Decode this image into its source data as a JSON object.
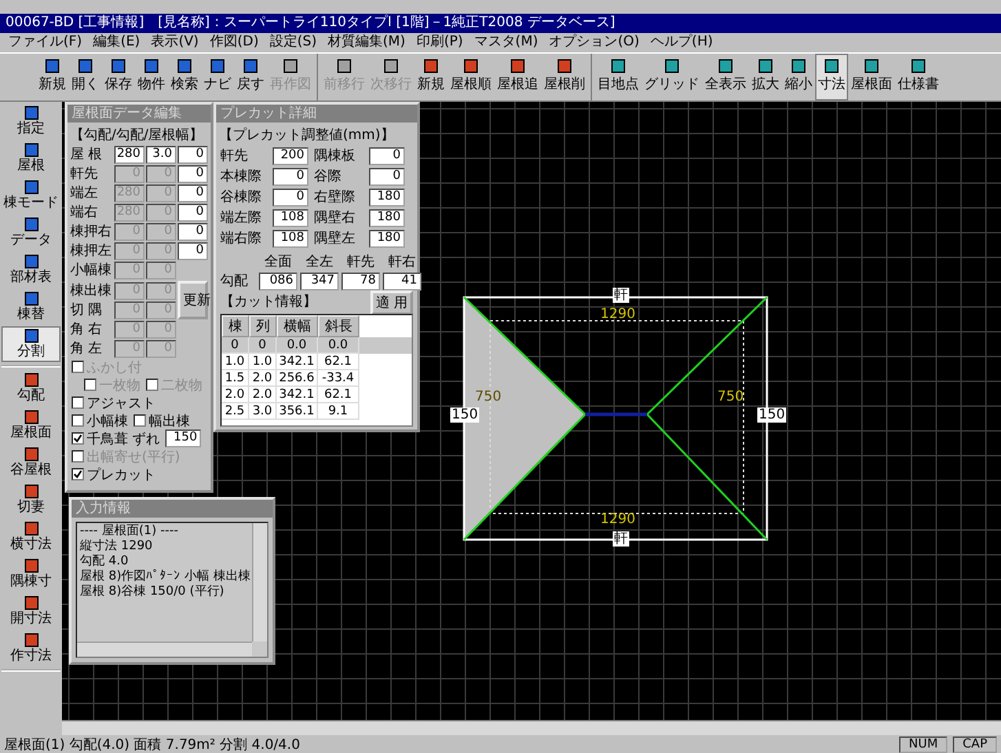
{
  "window": {
    "title": "00067-BD [工事情報]　[見名称]：スーパートライ110タイプⅠ [1階]－1純正T2008 データベース]"
  },
  "menu": [
    "ファイル(F)",
    "編集(E)",
    "表示(V)",
    "作図(D)",
    "設定(S)",
    "材質編集(M)",
    "印刷(P)",
    "マスタ(M)",
    "オプション(O)",
    "ヘルプ(H)"
  ],
  "toolbar": [
    [
      {
        "label": "新規",
        "disabled": false,
        "selected": false
      },
      {
        "label": "開く",
        "disabled": false,
        "selected": false
      },
      {
        "label": "保存",
        "disabled": false,
        "selected": false
      },
      {
        "label": "物件",
        "disabled": false,
        "selected": false
      },
      {
        "label": "検索",
        "disabled": false,
        "selected": false
      },
      {
        "label": "ナビ",
        "disabled": false,
        "selected": false
      },
      {
        "label": "戻す",
        "disabled": false,
        "selected": false
      },
      {
        "label": "再作図",
        "disabled": true,
        "selected": false
      }
    ],
    [
      {
        "label": "前移行",
        "disabled": true,
        "selected": false
      },
      {
        "label": "次移行",
        "disabled": true,
        "selected": false
      },
      {
        "label": "新規",
        "disabled": false,
        "selected": false
      },
      {
        "label": "屋根順",
        "disabled": false,
        "selected": false
      },
      {
        "label": "屋根追",
        "disabled": false,
        "selected": false
      },
      {
        "label": "屋根削",
        "disabled": false,
        "selected": false
      }
    ],
    [
      {
        "label": "目地点",
        "disabled": false,
        "selected": false
      },
      {
        "label": "グリッド",
        "disabled": false,
        "selected": false
      },
      {
        "label": "全表示",
        "disabled": false,
        "selected": false
      },
      {
        "label": "拡大",
        "disabled": false,
        "selected": false
      },
      {
        "label": "縮小",
        "disabled": false,
        "selected": false
      },
      {
        "label": "寸法",
        "disabled": false,
        "selected": true
      },
      {
        "label": "屋根面",
        "disabled": false,
        "selected": false
      },
      {
        "label": "仕様書",
        "disabled": false,
        "selected": false
      }
    ]
  ],
  "side_tools": [
    [
      {
        "label": "指定",
        "selected": false
      },
      {
        "label": "屋根",
        "selected": false
      },
      {
        "label": "棟モード",
        "selected": false
      },
      {
        "label": "データ",
        "selected": false
      },
      {
        "label": "部材表",
        "selected": false
      },
      {
        "label": "棟替",
        "selected": false
      },
      {
        "label": "分割",
        "selected": true
      }
    ],
    [
      {
        "label": "勾配",
        "selected": false
      },
      {
        "label": "屋根面",
        "selected": false
      },
      {
        "label": "谷屋根",
        "selected": false
      },
      {
        "label": "切妻",
        "selected": false
      },
      {
        "label": "横寸法",
        "selected": false
      },
      {
        "label": "隅棟寸",
        "selected": false
      },
      {
        "label": "開寸法",
        "selected": false
      },
      {
        "label": "作寸法",
        "selected": false
      }
    ]
  ],
  "roof_panel": {
    "title": "屋根面データ編集",
    "heading": "【勾配/勾配/屋根幅】",
    "rows": [
      {
        "label": "屋 根",
        "values": [
          {
            "text": "280",
            "disabled": false
          },
          {
            "text": "3.0",
            "disabled": false
          },
          {
            "text": "0",
            "disabled": false
          }
        ]
      },
      {
        "label": "軒先",
        "values": [
          {
            "text": "0",
            "disabled": true
          },
          {
            "text": "0",
            "disabled": true
          },
          {
            "text": "0",
            "disabled": false
          }
        ]
      },
      {
        "label": "端左",
        "values": [
          {
            "text": "280",
            "disabled": true
          },
          {
            "text": "0",
            "disabled": true
          },
          {
            "text": "0",
            "disabled": false
          }
        ]
      },
      {
        "label": "端右",
        "values": [
          {
            "text": "280",
            "disabled": true
          },
          {
            "text": "0",
            "disabled": true
          },
          {
            "text": "0",
            "disabled": false
          }
        ]
      },
      {
        "label": "棟押右",
        "values": [
          {
            "text": "0",
            "disabled": true
          },
          {
            "text": "0",
            "disabled": true
          },
          {
            "text": "0",
            "disabled": false
          }
        ]
      },
      {
        "label": "棟押左",
        "values": [
          {
            "text": "0",
            "disabled": true
          },
          {
            "text": "0",
            "disabled": true
          },
          {
            "text": "0",
            "disabled": false
          }
        ]
      },
      {
        "label": "小幅棟",
        "values": [
          {
            "text": "0",
            "disabled": true
          },
          {
            "text": "0",
            "disabled": true
          }
        ]
      },
      {
        "label": "棟出棟",
        "values": [
          {
            "text": "0",
            "disabled": true
          },
          {
            "text": "0",
            "disabled": true
          }
        ]
      },
      {
        "label": "切 隅",
        "values": [
          {
            "text": "0",
            "disabled": true
          },
          {
            "text": "0",
            "disabled": true
          }
        ]
      },
      {
        "label": "角 右",
        "values": [
          {
            "text": "0",
            "disabled": true
          },
          {
            "text": "0",
            "disabled": true
          }
        ]
      },
      {
        "label": "角 左",
        "values": [
          {
            "text": "0",
            "disabled": true
          },
          {
            "text": "0",
            "disabled": true
          }
        ]
      }
    ],
    "update_button": "更新",
    "options": [
      [
        {
          "kind": "checkbox",
          "label": "ふかし付",
          "checked": false,
          "disabled": true
        }
      ],
      [
        {
          "kind": "checkbox",
          "label": "一枚物",
          "checked": false,
          "disabled": true
        },
        {
          "kind": "checkbox",
          "label": "二枚物",
          "checked": false,
          "disabled": true
        }
      ],
      [
        {
          "kind": "checkbox",
          "label": "アジャスト",
          "checked": false,
          "disabled": false
        }
      ],
      [
        {
          "kind": "checkbox",
          "label": "小幅棟",
          "checked": false,
          "disabled": false
        },
        {
          "kind": "checkbox",
          "label": "幅出棟",
          "checked": false,
          "disabled": false
        }
      ],
      [
        {
          "kind": "checkbox",
          "label": "千鳥葺 ずれ",
          "checked": true,
          "disabled": false
        },
        {
          "kind": "field",
          "value": "150"
        }
      ],
      [
        {
          "kind": "checkbox",
          "label": "出幅寄せ(平行)",
          "checked": false,
          "disabled": true
        }
      ],
      [
        {
          "kind": "checkbox",
          "label": "プレカット",
          "checked": true,
          "disabled": false
        }
      ]
    ]
  },
  "precut_panel": {
    "title": "プレカット詳細",
    "heading": "【プレカット調整値(mm)】",
    "pairs": [
      [
        {
          "label": "軒先",
          "value": "200"
        },
        {
          "label": "隅棟板",
          "value": "0"
        }
      ],
      [
        {
          "label": "本棟際",
          "value": "0"
        },
        {
          "label": "谷際",
          "value": "0"
        }
      ],
      [
        {
          "label": "谷棟際",
          "value": "0"
        },
        {
          "label": "右壁際",
          "value": "180"
        }
      ],
      [
        {
          "label": "端左際",
          "value": "108"
        },
        {
          "label": "隅壁右",
          "value": "180"
        }
      ],
      [
        {
          "label": "端右際",
          "value": "108"
        },
        {
          "label": "隅壁左",
          "value": "180"
        }
      ]
    ],
    "angle_headers": [
      "全面",
      "全左",
      "軒先",
      "軒右"
    ],
    "angle_label": "勾配",
    "angle_values": [
      "086",
      "347",
      "78",
      "41"
    ],
    "cut_heading": "【カット情報】",
    "apply_button": "適 用",
    "columns": [
      "棟",
      "列",
      "横幅",
      "斜長"
    ],
    "rows": [
      {
        "cells": [
          "0",
          "0",
          "0.0",
          "0.0"
        ],
        "selected": true
      },
      {
        "cells": [
          "1.0",
          "1.0",
          "342.1",
          "62.1"
        ],
        "selected": false
      },
      {
        "cells": [
          "1.5",
          "2.0",
          "256.6",
          "-33.4"
        ],
        "selected": false
      },
      {
        "cells": [
          "2.0",
          "2.0",
          "342.1",
          "62.1"
        ],
        "selected": false
      },
      {
        "cells": [
          "2.5",
          "3.0",
          "356.1",
          "9.1"
        ],
        "selected": false
      }
    ]
  },
  "info_panel": {
    "title": "入力情報",
    "lines": [
      "---- 屋根面(1) ----",
      "縦寸法 1290",
      "勾配 4.0",
      "屋根 8)作図ﾊﾟﾀｰﾝ 小幅 棟出棟",
      "屋根 8)谷棟 150/0 (平行)"
    ]
  },
  "canvas": {
    "top_dimension": "1290",
    "bottom_dimension": "1290",
    "left_dimension": "750",
    "right_dimension": "750",
    "left_tag": "150",
    "right_tag": "150",
    "top_tag": "軒",
    "bottom_tag": "軒"
  },
  "status_bar": {
    "message": "屋根面(1) 勾配(4.0) 面積 7.79m² 分割 4.0/4.0",
    "cells": [
      "NUM",
      "CAP"
    ]
  }
}
